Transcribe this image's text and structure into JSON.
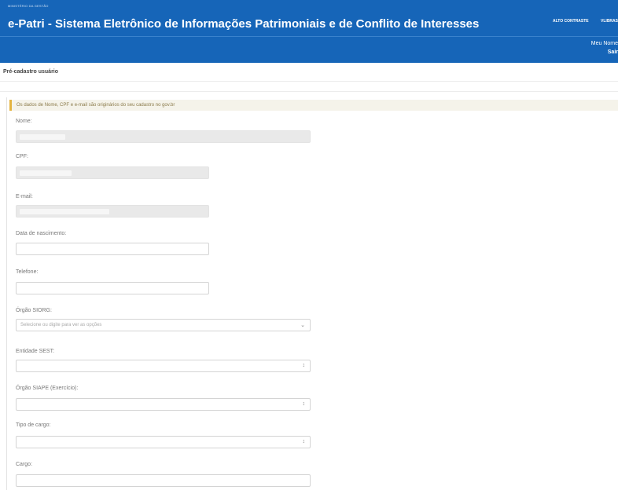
{
  "header": {
    "gov_line": "MINISTÉRIO DA GESTÃO",
    "title": "e-Patri - Sistema Eletrônico de Informações Patrimoniais e de Conflito de Interesses",
    "links": [
      "ALTO CONTRASTE",
      "VLIBRAS"
    ],
    "user_name": "Meu Nome",
    "user_action": "Sair"
  },
  "page": {
    "title": "Pré-cadastro usuário",
    "notice": "Os dados de Nome, CPF e e-mail são originários do seu cadastro no gov.br"
  },
  "form": {
    "nome_label": "Nome:",
    "cpf_label": "CPF:",
    "email_label": "E-mail:",
    "nascimento_label": "Data de nascimento:",
    "telefone_label": "Telefone:",
    "orgao_siorg_label": "Órgão SIORG:",
    "orgao_siorg_placeholder": "Selecione ou digite para ver as opções",
    "entidade_sest_label": "Entidade SEST:",
    "orgao_siape_label": "Órgão SIAPE (Exercício):",
    "tipo_cargo_label": "Tipo de cargo:",
    "cargo_label": "Cargo:",
    "chevron": "⌄",
    "updown": "↕"
  },
  "colors": {
    "header_bg": "#1665b8",
    "notice_border": "#e4b440"
  }
}
